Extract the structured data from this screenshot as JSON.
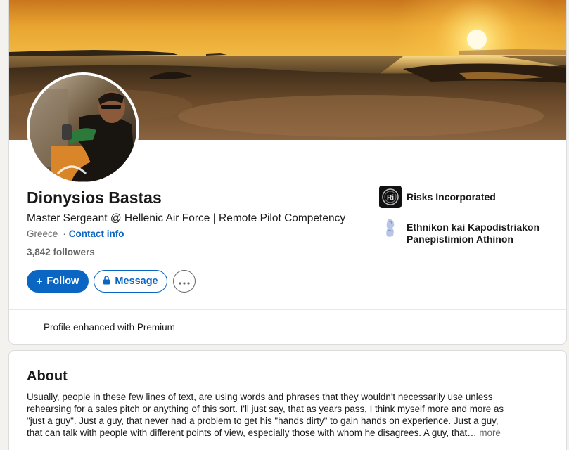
{
  "profile": {
    "name": "Dionysios Bastas",
    "headline": "Master Sergeant @ Hellenic Air Force | Remote Pilot Competency",
    "location": "Greece",
    "separator": "·",
    "contact_info_label": "Contact info",
    "followers": "3,842 followers"
  },
  "actions": {
    "follow_label": "Follow",
    "follow_icon": "+",
    "message_label": "Message",
    "message_icon": "lock-icon",
    "more_icon": "ellipsis-icon"
  },
  "organizations": [
    {
      "name": "Risks Incorporated",
      "logo": "risks-incorporated-logo"
    },
    {
      "name": "Ethnikon kai Kapodistriakon Panepistimion Athinon",
      "logo": "university-seal-logo"
    }
  ],
  "premium": {
    "text": "Profile enhanced with Premium",
    "icon": "premium-badge-icon"
  },
  "about": {
    "title": "About",
    "lines": [
      "Usually, people in these few lines of text, are using words and phrases that they wouldn't necessarily use unless",
      "rehearsing for a sales pitch or anything of this sort. I'll just say, that as years pass, I think myself more and more as",
      "\"just a guy\". Just a guy, that never had a problem to get his \"hands dirty\" to gain hands on experience.  Just a guy,",
      "that can talk with people with different points of view, especially those with whom he disagrees. A guy, that"
    ],
    "ellipsis": "…",
    "more_label": "more"
  },
  "colors": {
    "accent": "#0a66c2",
    "page_background": "#f3f2ef",
    "card_background": "#ffffff",
    "premium_gold": "#c37d16"
  }
}
